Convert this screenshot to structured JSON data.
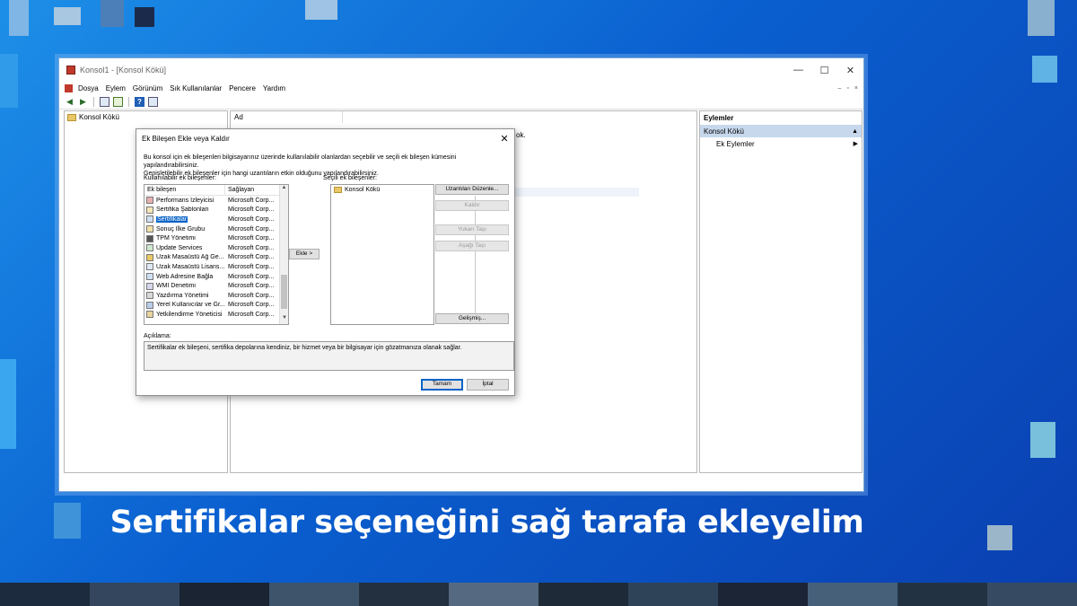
{
  "window": {
    "title": "Konsol1 - [Konsol Kökü]",
    "controls": [
      "—",
      "☐",
      "✕"
    ]
  },
  "menubar": {
    "items": [
      "Dosya",
      "Eylem",
      "Görünüm",
      "Sık Kullanılanlar",
      "Pencere",
      "Yardım"
    ],
    "mini_controls": [
      "–",
      "▫",
      "×"
    ]
  },
  "toolbar": {
    "back": "◀",
    "forward": "▶",
    "help": "?"
  },
  "tree": {
    "root": "Konsol Kökü"
  },
  "center": {
    "column_header": "Ad",
    "row_fragment": "ok."
  },
  "actions": {
    "header": "Eylemler",
    "selected": "Konsol Kökü",
    "items": [
      "Ek Eylemler"
    ],
    "collapse": "▲",
    "arrow": "▶"
  },
  "dialog": {
    "title": "Ek Bileşen Ekle veya Kaldır",
    "close": "✕",
    "description_line1": "Bu konsol için ek bileşenleri bilgisayarınız üzerinde kullanılabilir olanlardan seçebilir ve seçili ek bileşen kümesini yapılandırabilirsiniz.",
    "description_line2": "Genişletilebilir ek bileşenler için hangi uzantıların etkin olduğunu yapılandırabilirsiniz.",
    "available_label": "Kullanılabilir ek bileşenler:",
    "col_snapin": "Ek bileşen",
    "col_vendor": "Sağlayan",
    "rows": [
      {
        "name": "Performans İzleyicisi",
        "vendor": "Microsoft Corp...",
        "icon": "performance-monitor-icon"
      },
      {
        "name": "Sertifika Şablonları",
        "vendor": "Microsoft Corp...",
        "icon": "certificate-templates-icon"
      },
      {
        "name": "Sertifikalar",
        "vendor": "Microsoft Corp...",
        "icon": "certificates-icon",
        "selected": true
      },
      {
        "name": "Sonuç İlke Grubu",
        "vendor": "Microsoft Corp...",
        "icon": "policy-result-icon"
      },
      {
        "name": "TPM Yönetimi",
        "vendor": "Microsoft Corp...",
        "icon": "tpm-icon"
      },
      {
        "name": "Update Services",
        "vendor": "Microsoft Corp...",
        "icon": "update-services-icon"
      },
      {
        "name": "Uzak Masaüstü Ağ Ge...",
        "vendor": "Microsoft Corp...",
        "icon": "rd-gateway-icon"
      },
      {
        "name": "Uzak Masaüstü Lisans...",
        "vendor": "Microsoft Corp...",
        "icon": "rd-licensing-icon"
      },
      {
        "name": "Web Adresine Bağla",
        "vendor": "Microsoft Corp...",
        "icon": "web-link-icon"
      },
      {
        "name": "WMI Denetimi",
        "vendor": "Microsoft Corp...",
        "icon": "wmi-icon"
      },
      {
        "name": "Yazdırma Yönetimi",
        "vendor": "Microsoft Corp...",
        "icon": "print-management-icon"
      },
      {
        "name": "Yerel Kullanıcılar ve Gr...",
        "vendor": "Microsoft Corp...",
        "icon": "local-users-icon"
      },
      {
        "name": "Yetkilendirme Yöneticisi",
        "vendor": "Microsoft Corp...",
        "icon": "authorization-manager-icon"
      }
    ],
    "add_button": "Ekle >",
    "selected_label": "Seçili ek bileşenler:",
    "selected_items": [
      "Konsol Kökü"
    ],
    "btn_extensions": "Uzantıları Düzenle...",
    "btn_remove": "Kaldır",
    "btn_up": "Yukarı Taşı",
    "btn_down": "Aşağı Taşı",
    "btn_advanced": "Gelişmiş...",
    "desc_label": "Açıklama:",
    "desc_text": "Sertifikalar ek bileşeni, sertifika depolarına kendiniz, bir hizmet veya bir bilgisayar için gözatmanıza olanak sağlar.",
    "ok": "Tamam",
    "cancel": "İptal"
  },
  "caption": "Sertifikalar seçeneğini sağ tarafa ekleyelim",
  "colors": {
    "accent": "#0a64c8",
    "background": "#0a5fcf",
    "selection": "#c7d8ec"
  }
}
